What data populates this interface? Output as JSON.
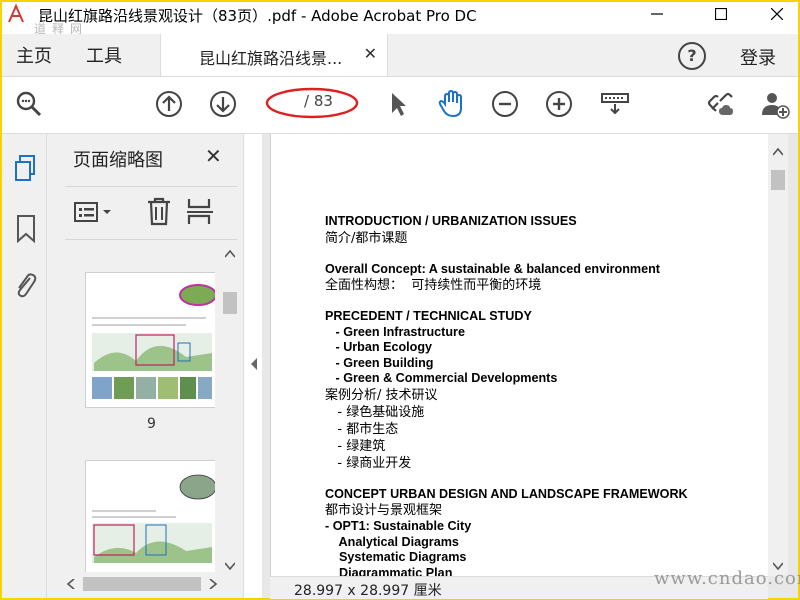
{
  "window": {
    "title": "昆山红旗路沿线景观设计（83页）.pdf - Adobe Acrobat Pro DC",
    "minimize_label": "—",
    "maximize_label": "☐",
    "close_label": "✕"
  },
  "watermark": {
    "top_left": "道释网",
    "bottom_right": "www.cndao.com"
  },
  "menubar": {
    "home": "主页",
    "tools": "工具",
    "doc_tab_label": "昆山红旗路沿线景...",
    "doc_tab_close": "✕",
    "help": "?",
    "login": "登录"
  },
  "toolbar": {
    "icons": [
      "zoom-search-icon",
      "page-up-icon",
      "page-down-icon",
      "select-arrow-icon",
      "hand-icon",
      "zoom-out-icon",
      "zoom-in-icon",
      "keyboard-icon",
      "link-cloud-icon",
      "add-user-icon"
    ],
    "current_page": "",
    "total_pages": "/ 83",
    "highlight_color": "#e02020",
    "accent_color": "#1a73c8"
  },
  "thumbnail_panel": {
    "title": "页面缩略图",
    "close": "✕",
    "pages": [
      {
        "label": "9"
      },
      {
        "label": ""
      }
    ]
  },
  "document": {
    "lines": [
      {
        "t": "INTRODUCTION / URBANIZATION ISSUES",
        "b": true
      },
      {
        "t": "简介/都市课题",
        "zh": true
      },
      {
        "gap": true
      },
      {
        "t": "Overall Concept: A sustainable & balanced environment",
        "b": true
      },
      {
        "t": "全面性构想：  可持续性而平衡的环境",
        "zh": true
      },
      {
        "gap": true
      },
      {
        "t": "PRECEDENT / TECHNICAL STUDY",
        "b": true
      },
      {
        "t": "   - Green Infrastructure",
        "b": true
      },
      {
        "t": "   - Urban Ecology",
        "b": true
      },
      {
        "t": "   - Green Building",
        "b": true
      },
      {
        "t": "   - Green & Commercial Developments",
        "b": true
      },
      {
        "t": "案例分析/ 技术研议",
        "zh": true
      },
      {
        "t": "   - 绿色基础设施",
        "zh": true
      },
      {
        "t": "   - 都市生态",
        "zh": true
      },
      {
        "t": "   - 绿建筑",
        "zh": true
      },
      {
        "t": "   - 绿商业开发",
        "zh": true
      },
      {
        "gap": true
      },
      {
        "t": "CONCEPT URBAN DESIGN AND LANDSCAPE FRAMEWORK",
        "b": true
      },
      {
        "t": "都市设计与景观框架",
        "zh": true
      },
      {
        "t": "- OPT1: Sustainable City",
        "b": true
      },
      {
        "t": "    Analytical Diagrams",
        "b": true
      },
      {
        "t": "    Systematic Diagrams",
        "b": true
      },
      {
        "t": "    Diagrammatic Plan",
        "b": true
      }
    ]
  },
  "status": {
    "page_size": "28.997 x 28.997 厘米"
  }
}
